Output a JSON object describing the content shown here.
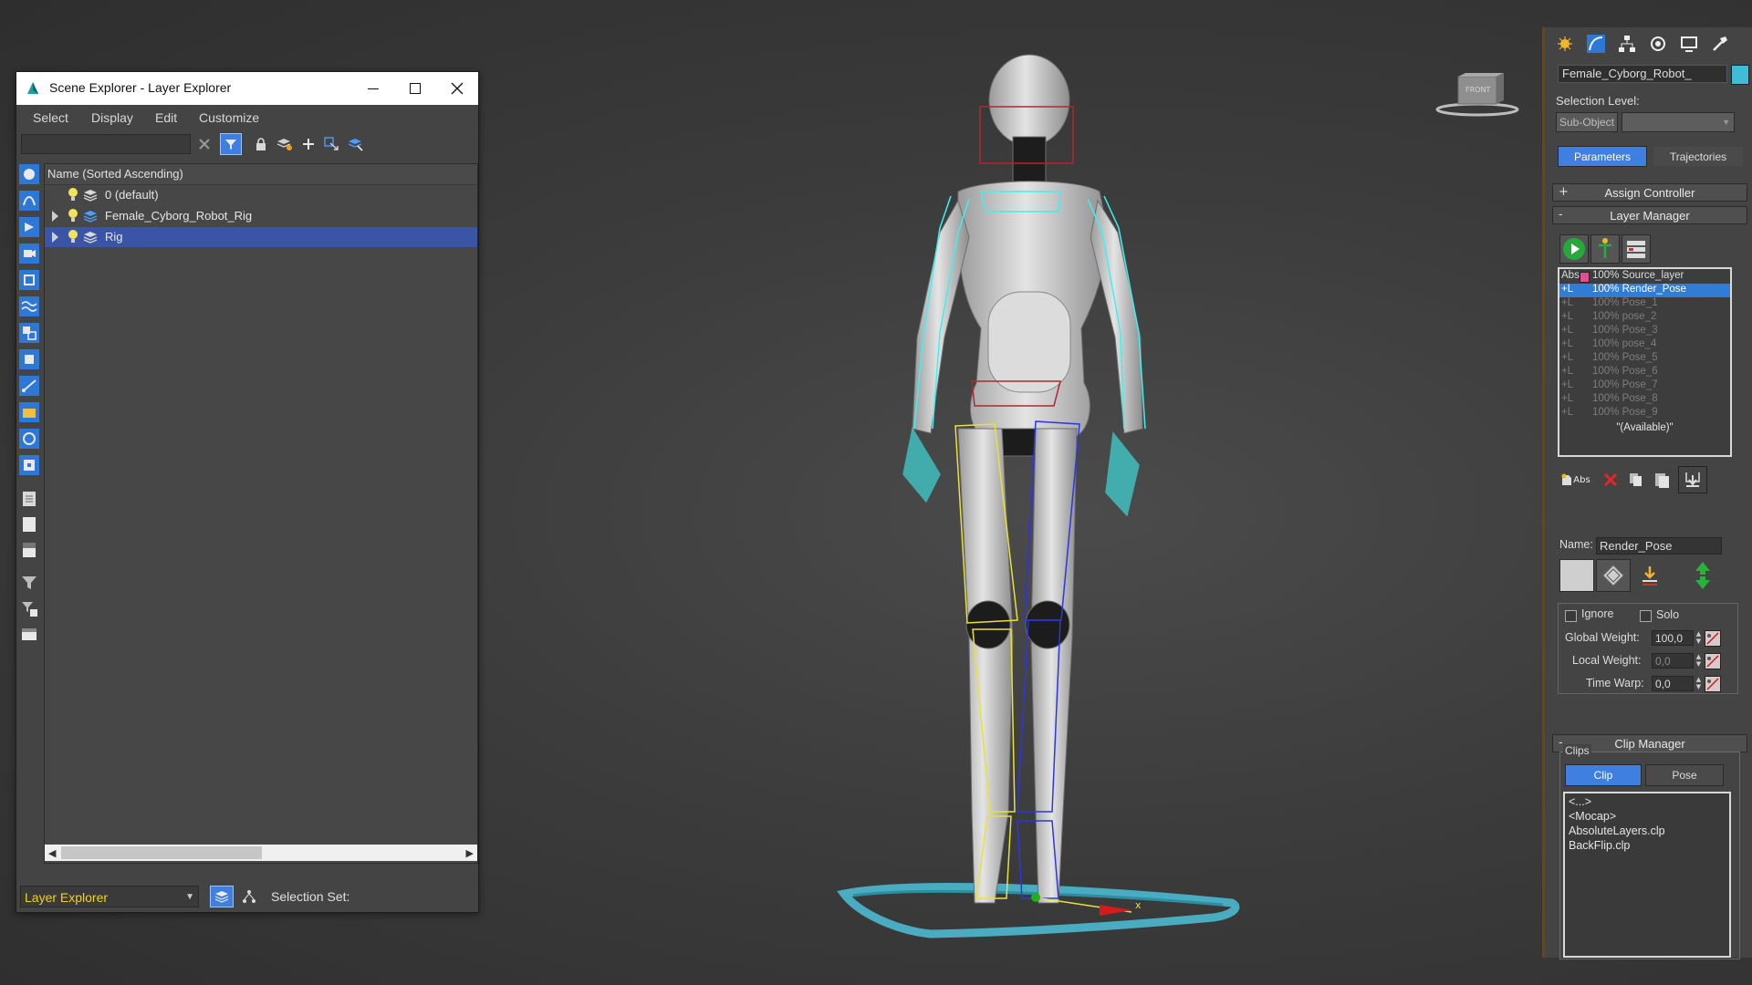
{
  "explorer": {
    "title": "Scene Explorer - Layer Explorer",
    "menu": [
      "Select",
      "Display",
      "Edit",
      "Customize"
    ],
    "column_header": "Name (Sorted Ascending)",
    "layers": [
      {
        "name": "0 (default)",
        "expandable": false,
        "selected": false
      },
      {
        "name": "Female_Cyborg_Robot_Rig",
        "expandable": true,
        "selected": false
      },
      {
        "name": "Rig",
        "expandable": true,
        "selected": true
      }
    ],
    "explorer_type": "Layer Explorer",
    "selection_set_label": "Selection Set:"
  },
  "viewport": {
    "viewcube_label": "FRONT",
    "axis_x_label": "x"
  },
  "command_panel": {
    "object_name": "Female_Cyborg_Robot_",
    "object_color": "#3fbcd6",
    "selection_level_label": "Selection Level:",
    "sub_object_label": "Sub-Object",
    "parameters_tab": "Parameters",
    "trajectories_tab": "Trajectories",
    "assign_controller": "Assign Controller",
    "layer_manager": "Layer Manager",
    "layer_rows": [
      {
        "prefix": "Abs",
        "text": "100% Source_layer",
        "state": "normal"
      },
      {
        "prefix": "+L",
        "text": "100% Render_Pose",
        "state": "selected"
      },
      {
        "prefix": "+L",
        "text": "100% Pose_1",
        "state": "dim"
      },
      {
        "prefix": "+L",
        "text": "100% pose_2",
        "state": "dim"
      },
      {
        "prefix": "+L",
        "text": "100% Pose_3",
        "state": "dim"
      },
      {
        "prefix": "+L",
        "text": "100% pose_4",
        "state": "dim"
      },
      {
        "prefix": "+L",
        "text": "100% Pose_5",
        "state": "dim"
      },
      {
        "prefix": "+L",
        "text": "100% Pose_6",
        "state": "dim"
      },
      {
        "prefix": "+L",
        "text": "100% Pose_7",
        "state": "dim"
      },
      {
        "prefix": "+L",
        "text": "100% Pose_8",
        "state": "dim"
      },
      {
        "prefix": "+L",
        "text": "100% Pose_9",
        "state": "dim"
      }
    ],
    "available_label": "\"(Available)\"",
    "add_abs_label": "Abs",
    "name_label": "Name:",
    "name_value": "Render_Pose",
    "ignore_label": "Ignore",
    "solo_label": "Solo",
    "global_weight_label": "Global Weight:",
    "global_weight_value": "100,0",
    "local_weight_label": "Local Weight:",
    "local_weight_value": "0,0",
    "time_warp_label": "Time Warp:",
    "time_warp_value": "0,0",
    "clip_manager": "Clip Manager",
    "clips_label": "Clips",
    "clip_tab": "Clip",
    "pose_tab": "Pose",
    "clip_items": [
      "<...>",
      "<Mocap>",
      "AbsoluteLayers.clp",
      "BackFlip.clp"
    ]
  }
}
